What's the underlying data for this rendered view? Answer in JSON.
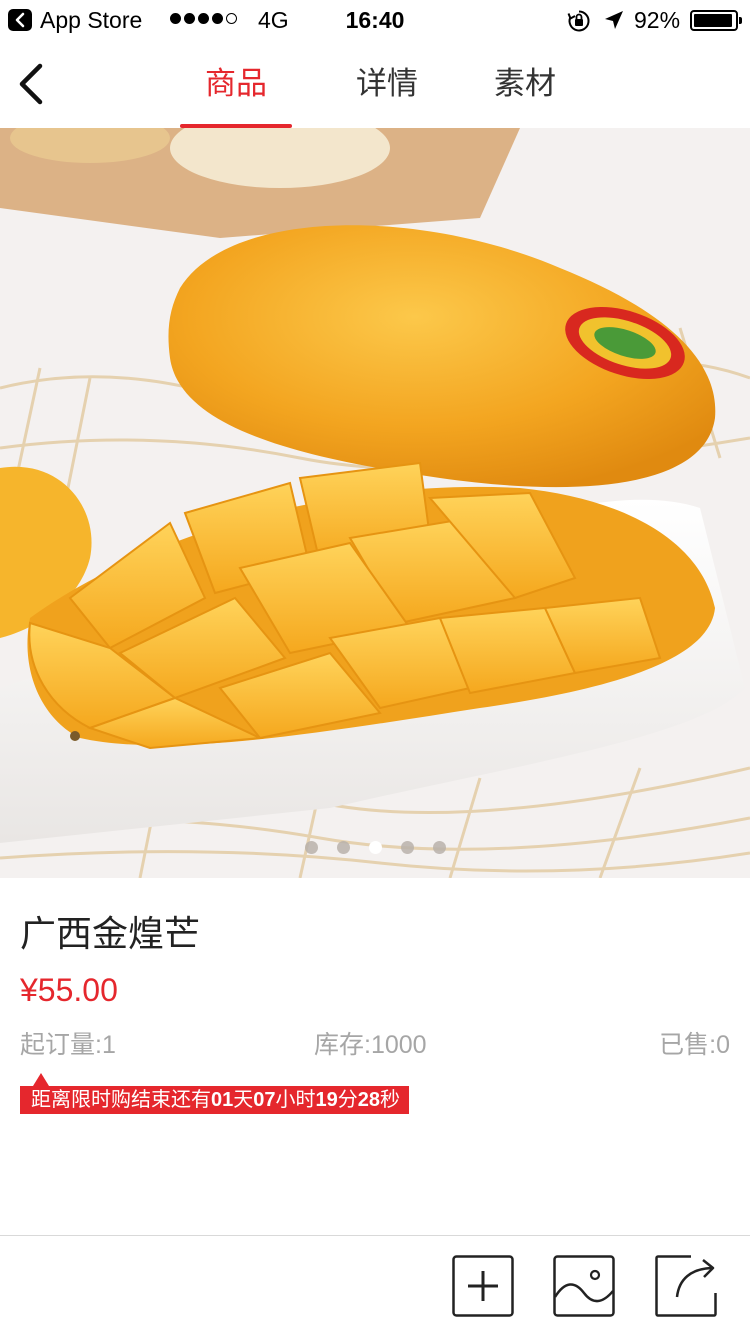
{
  "status_bar": {
    "app_name": "App Store",
    "network": "4G",
    "time": "16:40",
    "battery": "92%",
    "battery_level": 0.92,
    "signal_bars": 4,
    "signal_max": 5
  },
  "nav": {
    "tabs": [
      {
        "label": "商品",
        "active": true
      },
      {
        "label": "详情",
        "active": false
      },
      {
        "label": "素材",
        "active": false
      }
    ]
  },
  "carousel": {
    "total": 5,
    "current": 3
  },
  "product": {
    "name": "广西金煌芒",
    "price": "¥55.00",
    "min_order": "起订量:1",
    "stock": "库存:1000",
    "sold": "已售:0"
  },
  "countdown": {
    "prefix": "距离限时购结束还有",
    "days": "01",
    "days_unit": "天",
    "hours": "07",
    "hours_unit": "小时",
    "minutes": "19",
    "minutes_unit": "分",
    "seconds": "28",
    "seconds_unit": "秒"
  },
  "toolbar": {
    "icons": [
      "add-icon",
      "image-icon",
      "share-icon"
    ]
  },
  "colors": {
    "accent": "#e5272d",
    "muted": "#a6a6a6",
    "mango": "#f5a623"
  }
}
